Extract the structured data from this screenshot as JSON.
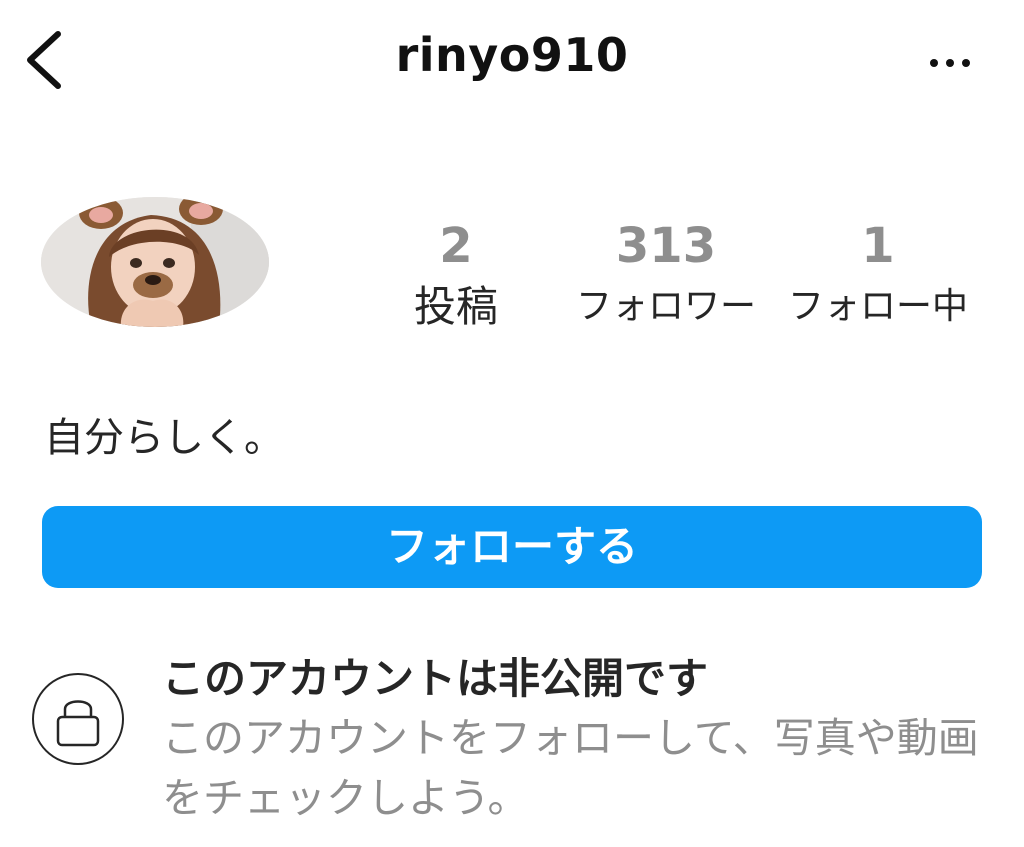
{
  "header": {
    "username": "rinyo910",
    "back_icon": "chevron-left-icon",
    "more_icon": "more-horizontal-icon"
  },
  "profile": {
    "avatar_description": "profile photo with dog-ear filter",
    "stats": [
      {
        "count": "2",
        "label": "投稿"
      },
      {
        "count": "313",
        "label": "フォロワー"
      },
      {
        "count": "1",
        "label": "フォロー中"
      }
    ],
    "bio": "自分らしく。"
  },
  "actions": {
    "follow_label": "フォローする",
    "accent_color": "#0d9af5"
  },
  "private_notice": {
    "icon": "lock-icon",
    "title": "このアカウントは非公開です",
    "description": "このアカウントをフォローして、写真や動画をチェックしよう。"
  }
}
